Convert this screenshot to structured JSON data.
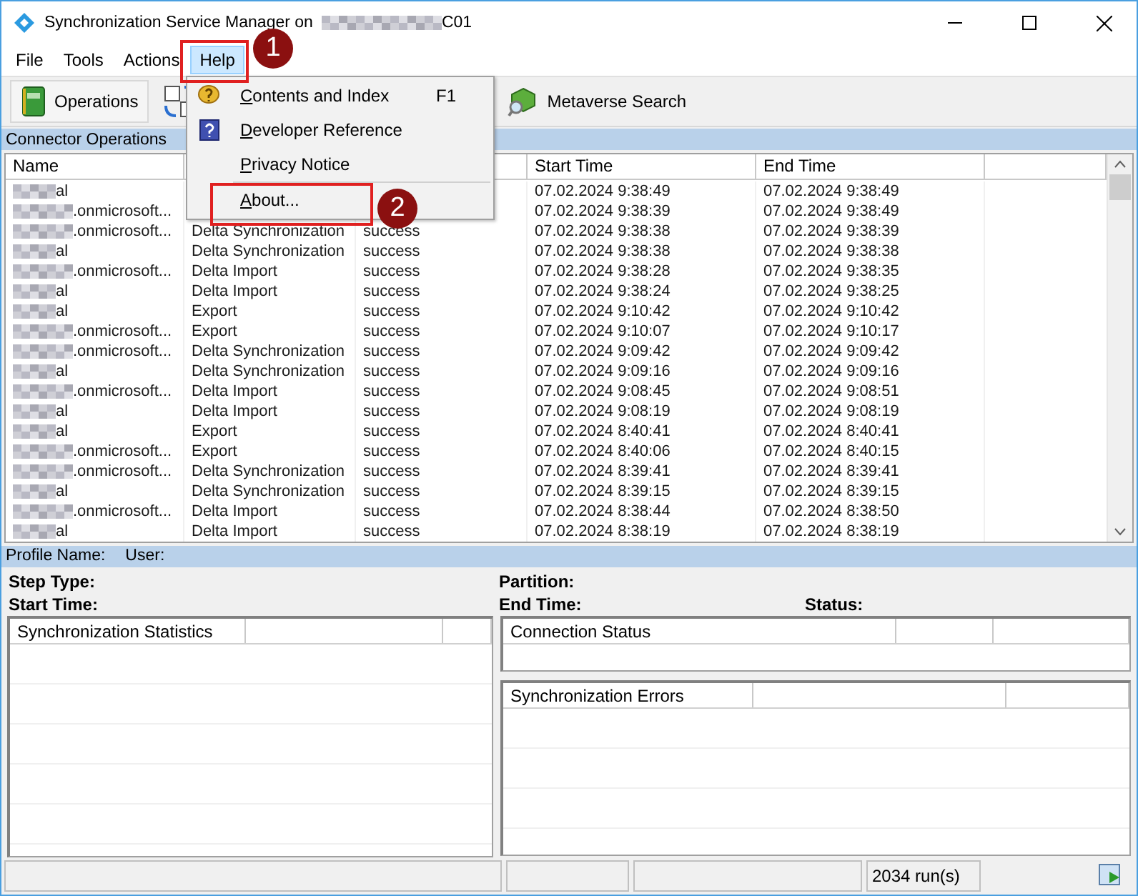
{
  "window": {
    "title": "Synchronization Service Manager on",
    "title_suffix": "C01"
  },
  "menu_bar": [
    {
      "label": "File",
      "selected": false
    },
    {
      "label": "Tools",
      "selected": false
    },
    {
      "label": "Actions",
      "selected": false
    },
    {
      "label": "Help",
      "selected": true
    }
  ],
  "toolbar": [
    {
      "kind": "operations",
      "label": "Operations"
    },
    {
      "kind": "sync"
    },
    {
      "kind": "metaverse",
      "label": "Metaverse Search"
    }
  ],
  "help_menu": {
    "items": [
      {
        "kind": "help",
        "label": "Contents and Index",
        "shortcut": "F1"
      },
      {
        "kind": "reference",
        "label": "Developer Reference"
      },
      {
        "kind": "plain",
        "label": "Privacy Notice"
      },
      {
        "kind": "separator"
      },
      {
        "kind": "plain",
        "label": "About..."
      }
    ]
  },
  "callouts": [
    {
      "number": "1"
    },
    {
      "number": "2"
    }
  ],
  "section_title": "Connector Operations",
  "table": {
    "columns": [
      "Name",
      "Start Time",
      "End Time"
    ],
    "rows": [
      {
        "name": "al",
        "start": "07.02.2024 9:38:49",
        "end": "07.02.2024 9:38:49"
      },
      {
        "name": ".onmicrosoft...",
        "start": "07.02.2024 9:38:39",
        "end": "07.02.2024 9:38:49"
      },
      {
        "name": ".onmicrosoft...",
        "operation": "Delta Synchronization",
        "status": "success",
        "start": "07.02.2024 9:38:38",
        "end": "07.02.2024 9:38:39"
      },
      {
        "name": "al",
        "operation": "Delta Synchronization",
        "status": "success",
        "start": "07.02.2024 9:38:38",
        "end": "07.02.2024 9:38:38"
      },
      {
        "name": ".onmicrosoft...",
        "operation": "Delta Import",
        "status": "success",
        "start": "07.02.2024 9:38:28",
        "end": "07.02.2024 9:38:35"
      },
      {
        "name": "al",
        "operation": "Delta Import",
        "status": "success",
        "start": "07.02.2024 9:38:24",
        "end": "07.02.2024 9:38:25"
      },
      {
        "name": "al",
        "operation": "Export",
        "status": "success",
        "start": "07.02.2024 9:10:42",
        "end": "07.02.2024 9:10:42"
      },
      {
        "name": ".onmicrosoft...",
        "operation": "Export",
        "status": "success",
        "start": "07.02.2024 9:10:07",
        "end": "07.02.2024 9:10:17"
      },
      {
        "name": ".onmicrosoft...",
        "operation": "Delta Synchronization",
        "status": "success",
        "start": "07.02.2024 9:09:42",
        "end": "07.02.2024 9:09:42"
      },
      {
        "name": "al",
        "operation": "Delta Synchronization",
        "status": "success",
        "start": "07.02.2024 9:09:16",
        "end": "07.02.2024 9:09:16"
      },
      {
        "name": ".onmicrosoft...",
        "operation": "Delta Import",
        "status": "success",
        "start": "07.02.2024 9:08:45",
        "end": "07.02.2024 9:08:51"
      },
      {
        "name": "al",
        "operation": "Delta Import",
        "status": "success",
        "start": "07.02.2024 9:08:19",
        "end": "07.02.2024 9:08:19"
      },
      {
        "name": "al",
        "operation": "Export",
        "status": "success",
        "start": "07.02.2024 8:40:41",
        "end": "07.02.2024 8:40:41"
      },
      {
        "name": ".onmicrosoft...",
        "operation": "Export",
        "status": "success",
        "start": "07.02.2024 8:40:06",
        "end": "07.02.2024 8:40:15"
      },
      {
        "name": ".onmicrosoft...",
        "operation": "Delta Synchronization",
        "status": "success",
        "start": "07.02.2024 8:39:41",
        "end": "07.02.2024 8:39:41"
      },
      {
        "name": "al",
        "operation": "Delta Synchronization",
        "status": "success",
        "start": "07.02.2024 8:39:15",
        "end": "07.02.2024 8:39:15"
      },
      {
        "name": ".onmicrosoft...",
        "operation": "Delta Import",
        "status": "success",
        "start": "07.02.2024 8:38:44",
        "end": "07.02.2024 8:38:50"
      },
      {
        "name": "al",
        "operation": "Delta Import",
        "status": "success",
        "start": "07.02.2024 8:38:19",
        "end": "07.02.2024 8:38:19"
      }
    ]
  },
  "profile_bar": [
    "Profile Name:",
    "User:"
  ],
  "details": {
    "left": [
      "Step Type:",
      "Start Time:"
    ],
    "right": [
      "Partition:",
      "End Time:"
    ],
    "status": "Status:"
  },
  "panels": {
    "statistics": "Synchronization Statistics",
    "connection": "Connection Status",
    "errors": "Synchronization Errors"
  },
  "status_bar": {
    "runs": "2034 run(s)"
  }
}
